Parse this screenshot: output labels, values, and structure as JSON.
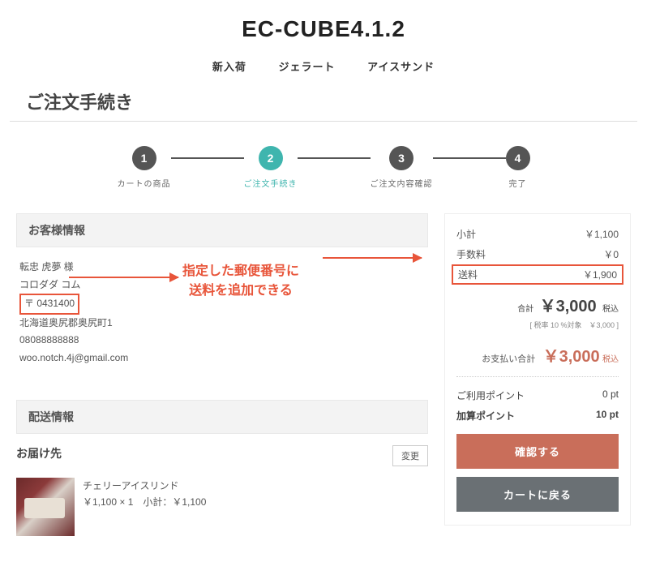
{
  "header": {
    "title": "EC-CUBE4.1.2"
  },
  "nav": {
    "items": [
      "新入荷",
      "ジェラート",
      "アイスサンド"
    ]
  },
  "page_title": "ご注文手続き",
  "steps": [
    {
      "num": "1",
      "label": "カートの商品"
    },
    {
      "num": "2",
      "label": "ご注文手続き"
    },
    {
      "num": "3",
      "label": "ご注文内容確認"
    },
    {
      "num": "4",
      "label": "完了"
    }
  ],
  "customer": {
    "section_title": "お客様情報",
    "name": "転忠 虎夢 様",
    "company": "コロダダ コム",
    "postal": "〒 0431400",
    "address": "北海道奥尻郡奥尻町1",
    "phone": "08088888888",
    "email": "woo.notch.4j@gmail.com"
  },
  "annotation": {
    "line1": "指定した郵便番号に",
    "line2": "送料を追加できる"
  },
  "shipping": {
    "section_title": "配送情報",
    "sub_title": "お届け先",
    "change_btn": "変更"
  },
  "product": {
    "name": "チェリーアイスリンド",
    "detail": "￥1,100 × 1　小計：￥1,100"
  },
  "summary": {
    "subtotal_label": "小計",
    "subtotal_value": "￥1,100",
    "fee_label": "手数料",
    "fee_value": "￥0",
    "shipping_label": "送料",
    "shipping_value": "￥1,900",
    "total_label": "合計",
    "total_value": "￥3,000",
    "total_suffix": "税込",
    "tax_note": "[ 税率 10 %対象　￥3,000 ]",
    "pay_label": "お支払い合計",
    "pay_value": "￥3,000",
    "pay_suffix": "税込",
    "use_point_label": "ご利用ポイント",
    "use_point_value": "0 pt",
    "add_point_label": "加算ポイント",
    "add_point_value": "10 pt",
    "confirm_btn": "確認する",
    "back_btn": "カートに戻る"
  }
}
